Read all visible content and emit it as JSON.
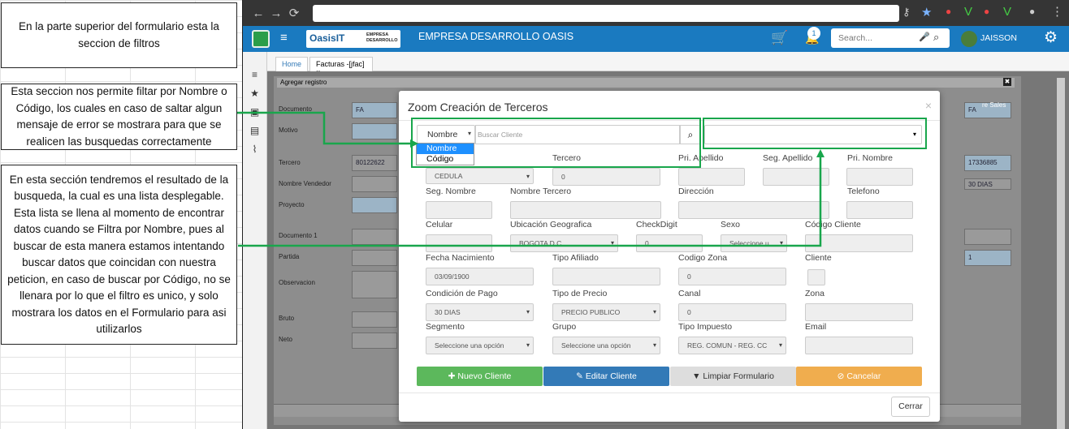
{
  "annotations": [
    "En la parte superior del formulario esta la seccion de filtros",
    "Esta seccion nos permite filtar por Nombre o Código, los cuales en caso de saltar algun mensaje de error se mostrara para que se realicen las busquedas correctamente",
    "En esta sección tendremos el resultado de la busqueda, la cual es una lista desplegable. Esta lista se llena al momento de encontrar datos cuando se Filtra por Nombre, pues al buscar de esta manera estamos intentando buscar datos que coincidan con nuestra peticion, en caso de buscar por Código, no se llenara por lo que el filtro es unico, y solo mostrara los datos en el Formulario para asi utilizarlos"
  ],
  "app": {
    "company": "EMPRESA DESARROLLO OASIS",
    "logo": "OasisIT",
    "logo_sub": "EMPRESA DESARROLLO",
    "search_placeholder": "Search...",
    "user": "JAISSON",
    "notif": "1"
  },
  "tabs": [
    "Home",
    "Facturas -[jfac]"
  ],
  "bg_form": {
    "header": "Agregar registro",
    "labels": [
      "Documento",
      "Motivo",
      "Tercero",
      "Nombre Vendedor",
      "Proyecto",
      "Documento 1",
      "Partida",
      "Observacion",
      "Bruto",
      "Neto"
    ],
    "doc_val": "FA",
    "tercero_val": "80122622",
    "right_doc": "FA",
    "right_nit": "17336885",
    "right_plazo": "30 DIAS",
    "right_num": "1",
    "right_sales": "re Sales"
  },
  "modal": {
    "title": "Zoom Creación de Terceros",
    "filter_selected": "Nombre",
    "filter_options": [
      "Nombre",
      "Código"
    ],
    "search_placeholder": "Buscar Cliente",
    "fields": [
      {
        "label": "Tercero",
        "value": "0"
      },
      {
        "label": "Pri. Apellido",
        "value": ""
      },
      {
        "label": "Seg. Apellido",
        "value": ""
      },
      {
        "label": "Pri. Nombre",
        "value": ""
      },
      {
        "label": "Seg. Nombre",
        "value": ""
      },
      {
        "label": "Nombre Tercero",
        "value": ""
      },
      {
        "label": "Dirección",
        "value": ""
      },
      {
        "label": "Telefono",
        "value": ""
      },
      {
        "label": "Celular",
        "value": ""
      },
      {
        "label": "Ubicación Geografica",
        "value": "BOGOTA D.C."
      },
      {
        "label": "CheckDigit",
        "value": "0"
      },
      {
        "label": "Sexo",
        "value": "Seleccione u"
      },
      {
        "label": "Código Cliente",
        "value": ""
      },
      {
        "label": "Fecha Nacimiento",
        "value": "03/09/1900"
      },
      {
        "label": "Tipo Afiliado",
        "value": ""
      },
      {
        "label": "Codigo Zona",
        "value": "0"
      },
      {
        "label": "Cliente",
        "value": ""
      },
      {
        "label": "Condición de Pago",
        "value": "30 DIAS"
      },
      {
        "label": "Tipo de Precio",
        "value": "PRECIO PUBLICO"
      },
      {
        "label": "Canal",
        "value": "0"
      },
      {
        "label": "Zona",
        "value": ""
      },
      {
        "label": "Segmento",
        "value": "Seleccione una opción"
      },
      {
        "label": "Grupo",
        "value": "Seleccione una opción"
      },
      {
        "label": "Tipo Impuesto",
        "value": "REG. COMUN - REG. CC"
      },
      {
        "label": "Email",
        "value": ""
      }
    ],
    "doc_type": "CEDULA",
    "buttons": {
      "nuevo": "Nuevo Cliente",
      "editar": "Editar Cliente",
      "limpiar": "Limpiar Formulario",
      "cancelar": "Cancelar"
    },
    "cerrar": "Cerrar"
  },
  "colors": {
    "green": "#5cb85c",
    "blue": "#337ab7",
    "gray": "#ddd",
    "orange": "#f0ad4e",
    "annot": "#19a64c"
  }
}
